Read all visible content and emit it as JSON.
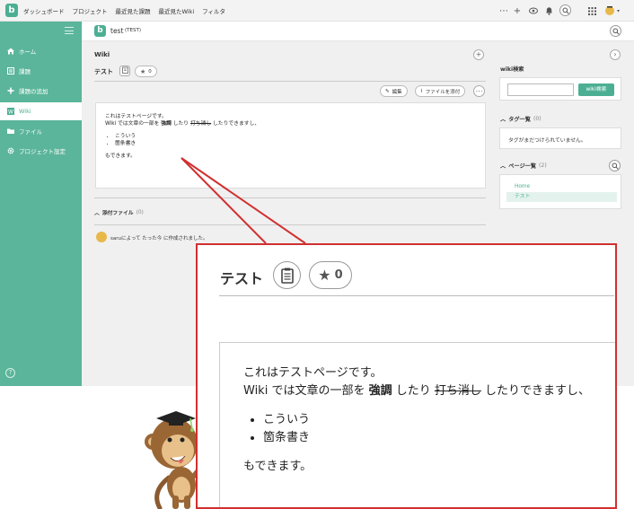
{
  "topnav": {
    "logo": "b",
    "items": [
      "ダッシュボード",
      "プロジェクト",
      "最近見た課題",
      "最近見たWiki",
      "フィルタ"
    ]
  },
  "sidebar": {
    "items": [
      {
        "label": "ホーム",
        "icon": "home-icon"
      },
      {
        "label": "課題",
        "icon": "list-icon"
      },
      {
        "label": "課題の追加",
        "icon": "plus-icon"
      },
      {
        "label": "Wiki",
        "icon": "wiki-icon"
      },
      {
        "label": "ファイル",
        "icon": "folder-icon"
      },
      {
        "label": "プロジェクト設定",
        "icon": "gear-icon"
      }
    ],
    "active_index": 3,
    "help": "?"
  },
  "project": {
    "icon_letter": "b",
    "name": "test",
    "key": "(TEST)"
  },
  "wiki": {
    "section_title": "Wiki",
    "page_title": "テスト",
    "star_count": "0",
    "edit_label": "編集",
    "attach_label": "ファイルを添付",
    "body": {
      "line1": "これはテストページです。",
      "line2_pre": "Wiki では文章の一部を ",
      "line2_bold": "強調",
      "line2_mid": " したり ",
      "line2_strike": "打ち消し",
      "line2_post": " したりできますし、",
      "list": [
        "こういう",
        "箇条書き"
      ],
      "line3": "もできます。"
    },
    "attachments_label": "添付ファイル",
    "attachments_count": "(0)",
    "created_by": "saruによって たった今 に作成されました。"
  },
  "right_panel": {
    "search_title": "wiki検索",
    "search_button": "wiki検索",
    "search_value": "",
    "tags_title": "タグ一覧",
    "tags_count": "(0)",
    "tags_empty": "タグがまだつけられていません。",
    "pages_title": "ページ一覧",
    "pages_count": "(2)",
    "pages": [
      "Home",
      "テスト"
    ]
  },
  "colors": {
    "brand": "#4caf93",
    "sidebar": "#5bb59a",
    "callout": "#d03030"
  }
}
